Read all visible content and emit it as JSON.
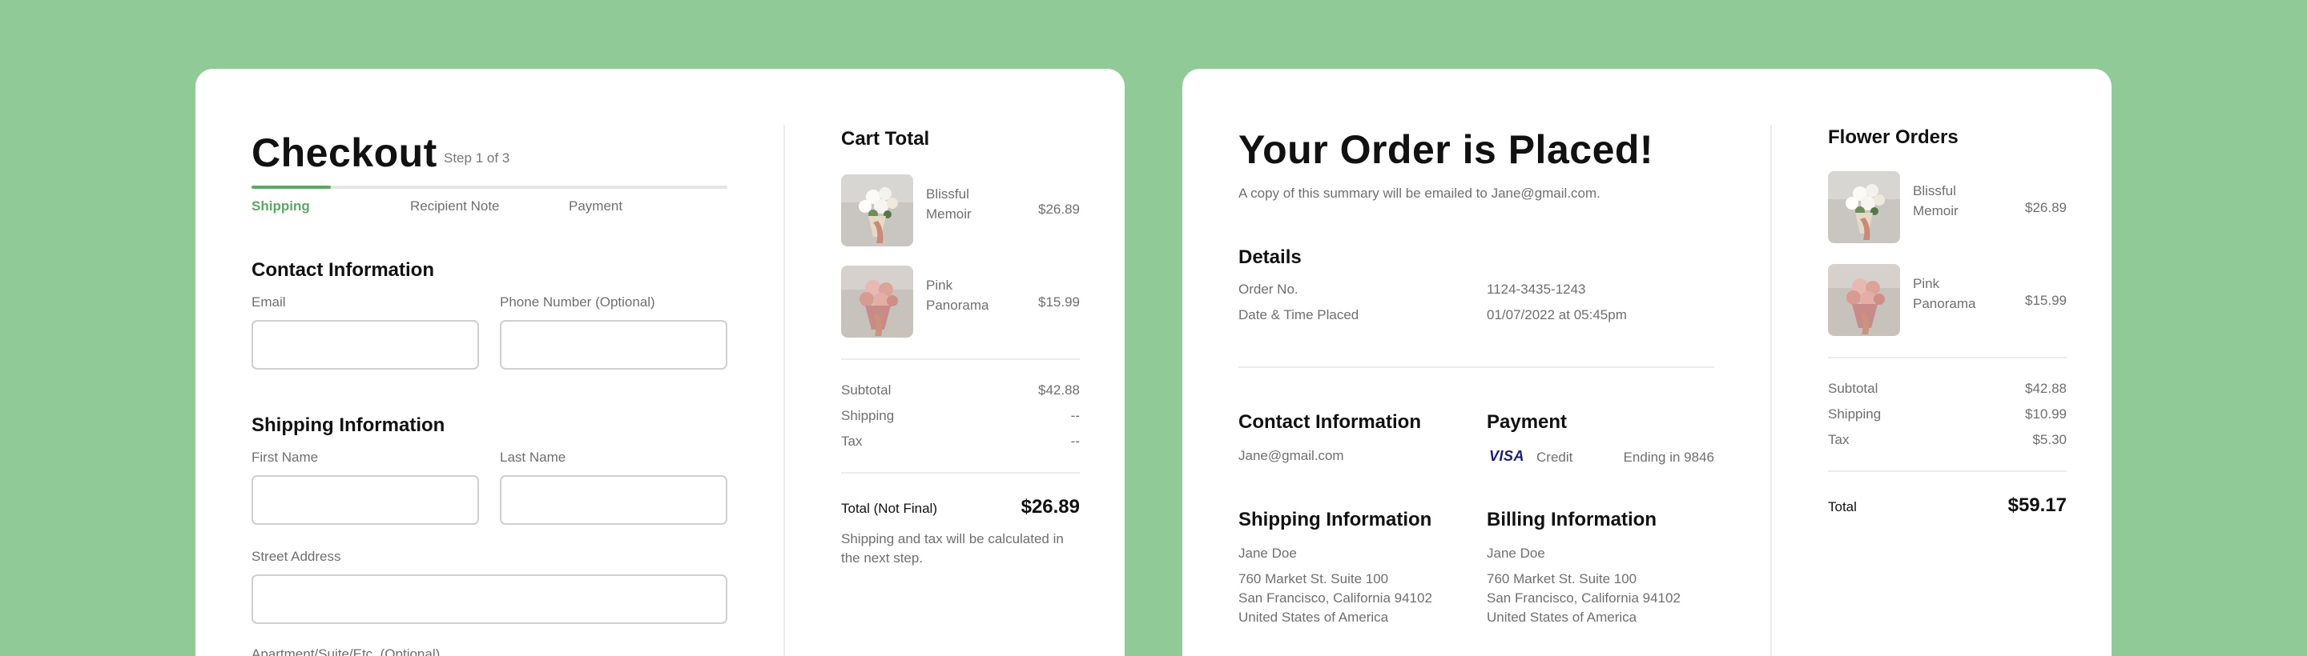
{
  "checkout": {
    "title": "Checkout",
    "step": "Step 1 of 3",
    "progress_fraction": 0.167,
    "steps": [
      "Shipping",
      "Recipient Note",
      "Payment"
    ],
    "contact_title": "Contact Information",
    "email_label": "Email",
    "phone_label": "Phone Number (Optional)",
    "shipping_title": "Shipping Information",
    "first_name_label": "First Name",
    "last_name_label": "Last Name",
    "street_label": "Street Address",
    "apartment_label": "Apartment/Suite/Etc. (Optional)"
  },
  "cart": {
    "title": "Cart Total",
    "items": [
      {
        "name": "Blissful Memoir",
        "price": "$26.89"
      },
      {
        "name": "Pink Panorama",
        "price": "$15.99"
      }
    ],
    "subtotal_label": "Subtotal",
    "subtotal": "$42.88",
    "shipping_label": "Shipping",
    "shipping": "--",
    "tax_label": "Tax",
    "tax": "--",
    "total_label": "Total (Not Final)",
    "total": "$26.89",
    "note": "Shipping and tax will be calculated in the next step."
  },
  "order": {
    "title": "Your Order is Placed!",
    "subtitle": "A copy of this summary will be emailed to Jane@gmail.com.",
    "details_title": "Details",
    "order_no_label": "Order No.",
    "order_no": "1124-3435-1243",
    "date_label": "Date & Time Placed",
    "date": "01/07/2022 at 05:45pm",
    "contact_title": "Contact Information",
    "contact_email": "Jane@gmail.com",
    "payment_title": "Payment",
    "card_brand": "VISA",
    "card_type": "Credit",
    "card_ending": "Ending in 9846",
    "shipping_title": "Shipping Information",
    "billing_title": "Billing Information",
    "shipping_address": {
      "name": "Jane Doe",
      "line1": "760 Market St. Suite 100",
      "line2": "San Francisco, California 94102",
      "line3": "United States of America"
    },
    "billing_address": {
      "name": "Jane Doe",
      "line1": "760 Market St. Suite 100",
      "line2": "San Francisco, California 94102",
      "line3": "United States of America"
    }
  },
  "flower_orders": {
    "title": "Flower Orders",
    "items": [
      {
        "name": "Blissful Memoir",
        "price": "$26.89"
      },
      {
        "name": "Pink Panorama",
        "price": "$15.99"
      }
    ],
    "subtotal_label": "Subtotal",
    "subtotal": "$42.88",
    "shipping_label": "Shipping",
    "shipping": "$10.99",
    "tax_label": "Tax",
    "tax": "$5.30",
    "total_label": "Total",
    "total": "$59.17"
  },
  "colors": {
    "background": "#90ca97",
    "accent": "#5ea765",
    "card": "#ffffff"
  }
}
